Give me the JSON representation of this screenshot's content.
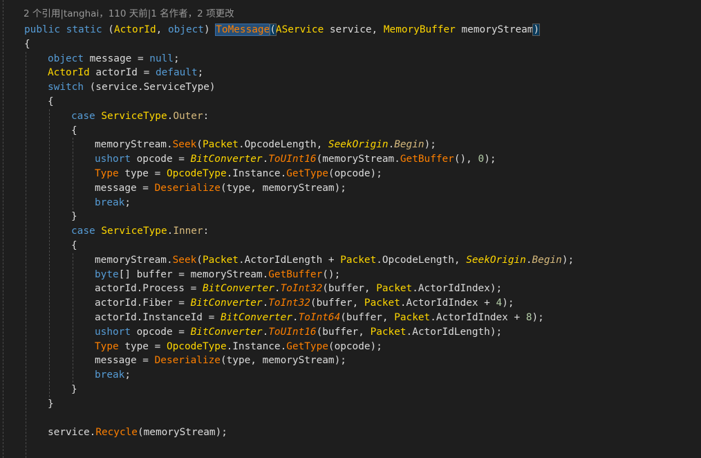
{
  "colors": {
    "background": "#1e1e1e",
    "keyword": "#569cd6",
    "type": "#ffd700",
    "method": "#ff8000",
    "plain": "#dcdcdc",
    "static_class": "#ffd700",
    "enum_member": "#d7ba7d",
    "number": "#b5cea8",
    "codelens": "#999999",
    "selection": "#264f78"
  },
  "codelens": {
    "text": "2 个引用|tanghai，110 天前|1 名作者，2 项更改"
  },
  "lines": [
    {
      "indent": 0,
      "tokens": [
        [
          "public",
          "kw"
        ],
        [
          " ",
          "p"
        ],
        [
          "static",
          "kw"
        ],
        [
          " (",
          "p"
        ],
        [
          "ActorId",
          "ty"
        ],
        [
          ", ",
          "p"
        ],
        [
          "object",
          "kw"
        ],
        [
          ") ",
          "p"
        ],
        [
          "ToMessage",
          "me hl"
        ],
        [
          "(",
          "p bhl"
        ],
        [
          "AService",
          "ty"
        ],
        [
          " service, ",
          "p"
        ],
        [
          "MemoryBuffer",
          "ty"
        ],
        [
          " memoryStream",
          "p"
        ],
        [
          ")",
          "p bhl"
        ]
      ]
    },
    {
      "indent": 0,
      "tokens": [
        [
          "{",
          "p"
        ]
      ]
    },
    {
      "indent": 1,
      "tokens": [
        [
          "object",
          "kw"
        ],
        [
          " message = ",
          "p"
        ],
        [
          "null",
          "kw"
        ],
        [
          ";",
          "p"
        ]
      ]
    },
    {
      "indent": 1,
      "tokens": [
        [
          "ActorId",
          "ty"
        ],
        [
          " actorId = ",
          "p"
        ],
        [
          "default",
          "kw"
        ],
        [
          ";",
          "p"
        ]
      ]
    },
    {
      "indent": 1,
      "tokens": [
        [
          "switch",
          "kw"
        ],
        [
          " (service.ServiceType)",
          "p"
        ]
      ]
    },
    {
      "indent": 1,
      "tokens": [
        [
          "{",
          "p"
        ]
      ]
    },
    {
      "indent": 2,
      "tokens": [
        [
          "case",
          "kw"
        ],
        [
          " ",
          "p"
        ],
        [
          "ServiceType",
          "ty"
        ],
        [
          ".",
          "p"
        ],
        [
          "Outer",
          "en"
        ],
        [
          ":",
          "p"
        ]
      ]
    },
    {
      "indent": 2,
      "tokens": [
        [
          "{",
          "p"
        ]
      ]
    },
    {
      "indent": 3,
      "tokens": [
        [
          "memoryStream.",
          "p"
        ],
        [
          "Seek",
          "me"
        ],
        [
          "(",
          "p"
        ],
        [
          "Packet",
          "ty"
        ],
        [
          ".OpcodeLength, ",
          "p"
        ],
        [
          "SeekOrigin",
          "ty it"
        ],
        [
          ".",
          "p"
        ],
        [
          "Begin",
          "en it"
        ],
        [
          ");",
          "p"
        ]
      ]
    },
    {
      "indent": 3,
      "tokens": [
        [
          "ushort",
          "kw"
        ],
        [
          " opcode = ",
          "p"
        ],
        [
          "BitConverter",
          "ty it"
        ],
        [
          ".",
          "p"
        ],
        [
          "ToUInt16",
          "me it"
        ],
        [
          "(memoryStream.",
          "p"
        ],
        [
          "GetBuffer",
          "me"
        ],
        [
          "(), ",
          "p"
        ],
        [
          "0",
          "nu"
        ],
        [
          ");",
          "p"
        ]
      ]
    },
    {
      "indent": 3,
      "tokens": [
        [
          "Type",
          "me"
        ],
        [
          " type = ",
          "p"
        ],
        [
          "OpcodeType",
          "ty"
        ],
        [
          ".Instance.",
          "p"
        ],
        [
          "GetType",
          "me"
        ],
        [
          "(opcode);",
          "p"
        ]
      ]
    },
    {
      "indent": 3,
      "tokens": [
        [
          "message = ",
          "p"
        ],
        [
          "Deserialize",
          "me"
        ],
        [
          "(type, memoryStream);",
          "p"
        ]
      ]
    },
    {
      "indent": 3,
      "tokens": [
        [
          "break",
          "kw"
        ],
        [
          ";",
          "p"
        ]
      ]
    },
    {
      "indent": 2,
      "tokens": [
        [
          "}",
          "p"
        ]
      ]
    },
    {
      "indent": 2,
      "tokens": [
        [
          "case",
          "kw"
        ],
        [
          " ",
          "p"
        ],
        [
          "ServiceType",
          "ty"
        ],
        [
          ".",
          "p"
        ],
        [
          "Inner",
          "en"
        ],
        [
          ":",
          "p"
        ]
      ]
    },
    {
      "indent": 2,
      "tokens": [
        [
          "{",
          "p"
        ]
      ]
    },
    {
      "indent": 3,
      "tokens": [
        [
          "memoryStream.",
          "p"
        ],
        [
          "Seek",
          "me"
        ],
        [
          "(",
          "p"
        ],
        [
          "Packet",
          "ty"
        ],
        [
          ".ActorIdLength + ",
          "p"
        ],
        [
          "Packet",
          "ty"
        ],
        [
          ".OpcodeLength, ",
          "p"
        ],
        [
          "SeekOrigin",
          "ty it"
        ],
        [
          ".",
          "p"
        ],
        [
          "Begin",
          "en it"
        ],
        [
          ");",
          "p"
        ]
      ]
    },
    {
      "indent": 3,
      "tokens": [
        [
          "byte",
          "kw"
        ],
        [
          "[] buffer = memoryStream.",
          "p"
        ],
        [
          "GetBuffer",
          "me"
        ],
        [
          "();",
          "p"
        ]
      ]
    },
    {
      "indent": 3,
      "tokens": [
        [
          "actorId.Process = ",
          "p"
        ],
        [
          "BitConverter",
          "ty it"
        ],
        [
          ".",
          "p"
        ],
        [
          "ToInt32",
          "me it"
        ],
        [
          "(buffer, ",
          "p"
        ],
        [
          "Packet",
          "ty"
        ],
        [
          ".ActorIdIndex);",
          "p"
        ]
      ]
    },
    {
      "indent": 3,
      "tokens": [
        [
          "actorId.Fiber = ",
          "p"
        ],
        [
          "BitConverter",
          "ty it"
        ],
        [
          ".",
          "p"
        ],
        [
          "ToInt32",
          "me it"
        ],
        [
          "(buffer, ",
          "p"
        ],
        [
          "Packet",
          "ty"
        ],
        [
          ".ActorIdIndex + ",
          "p"
        ],
        [
          "4",
          "nu"
        ],
        [
          ");",
          "p"
        ]
      ]
    },
    {
      "indent": 3,
      "tokens": [
        [
          "actorId.InstanceId = ",
          "p"
        ],
        [
          "BitConverter",
          "ty it"
        ],
        [
          ".",
          "p"
        ],
        [
          "ToInt64",
          "me it"
        ],
        [
          "(buffer, ",
          "p"
        ],
        [
          "Packet",
          "ty"
        ],
        [
          ".ActorIdIndex + ",
          "p"
        ],
        [
          "8",
          "nu"
        ],
        [
          ");",
          "p"
        ]
      ]
    },
    {
      "indent": 3,
      "tokens": [
        [
          "ushort",
          "kw"
        ],
        [
          " opcode = ",
          "p"
        ],
        [
          "BitConverter",
          "ty it"
        ],
        [
          ".",
          "p"
        ],
        [
          "ToUInt16",
          "me it"
        ],
        [
          "(buffer, ",
          "p"
        ],
        [
          "Packet",
          "ty"
        ],
        [
          ".ActorIdLength);",
          "p"
        ]
      ]
    },
    {
      "indent": 3,
      "tokens": [
        [
          "Type",
          "me"
        ],
        [
          " type = ",
          "p"
        ],
        [
          "OpcodeType",
          "ty"
        ],
        [
          ".Instance.",
          "p"
        ],
        [
          "GetType",
          "me"
        ],
        [
          "(opcode);",
          "p"
        ]
      ]
    },
    {
      "indent": 3,
      "tokens": [
        [
          "message = ",
          "p"
        ],
        [
          "Deserialize",
          "me"
        ],
        [
          "(type, memoryStream);",
          "p"
        ]
      ]
    },
    {
      "indent": 3,
      "tokens": [
        [
          "break",
          "kw"
        ],
        [
          ";",
          "p"
        ]
      ]
    },
    {
      "indent": 2,
      "tokens": [
        [
          "}",
          "p"
        ]
      ]
    },
    {
      "indent": 1,
      "tokens": [
        [
          "}",
          "p"
        ]
      ]
    },
    {
      "indent": 1,
      "tokens": []
    },
    {
      "indent": 1,
      "tokens": [
        [
          "service.",
          "p"
        ],
        [
          "Recycle",
          "me"
        ],
        [
          "(memoryStream);",
          "p"
        ]
      ]
    }
  ]
}
